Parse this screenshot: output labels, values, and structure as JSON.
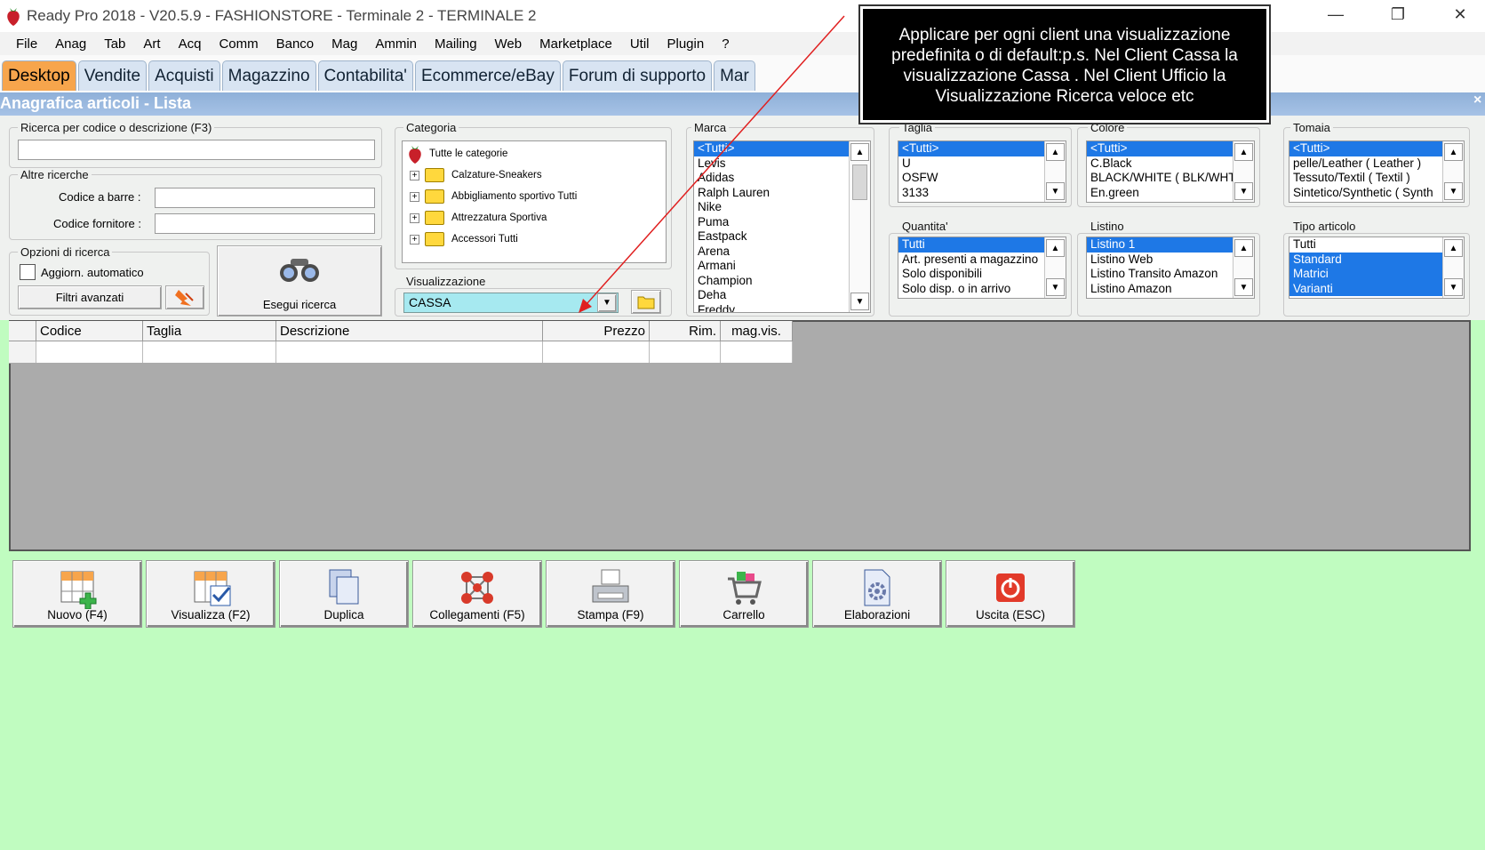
{
  "window": {
    "title": "Ready Pro 2018 - V20.5.9 - FASHIONSTORE - Terminale 2 - TERMINALE 2",
    "minimize": "—",
    "restore": "❐",
    "close": "✕"
  },
  "menu": [
    "File",
    "Anag",
    "Tab",
    "Art",
    "Acq",
    "Comm",
    "Banco",
    "Mag",
    "Ammin",
    "Mailing",
    "Web",
    "Marketplace",
    "Util",
    "Plugin",
    "?"
  ],
  "tabs": [
    "Desktop",
    "Vendite",
    "Acquisti",
    "Magazzino",
    "Contabilita'",
    "Ecommerce/eBay",
    "Forum di supporto",
    "Mar"
  ],
  "panel": {
    "title": "Anagrafica articoli  - Lista",
    "close": "×"
  },
  "search": {
    "label": "Ricerca per codice o descrizione (F3)",
    "value": ""
  },
  "other": {
    "label": "Altre ricerche",
    "barcode_label": "Codice a barre :",
    "supplier_label": "Codice fornitore :"
  },
  "options": {
    "label": "Opzioni di ricerca",
    "auto_update": "Aggiorn. automatico",
    "advanced": "Filtri avanzati",
    "run": "Esegui ricerca"
  },
  "categoria": {
    "label": "Categoria",
    "root": "Tutte le categorie",
    "items": [
      "Calzature-Sneakers",
      "Abbigliamento sportivo Tutti",
      "Attrezzatura Sportiva",
      "Accessori Tutti"
    ]
  },
  "visualizzazione": {
    "label": "Visualizzazione",
    "value": "CASSA"
  },
  "marca": {
    "label": "Marca",
    "items": [
      "<Tutti>",
      "Levis",
      "Adidas",
      "Ralph Lauren",
      "Nike",
      "Puma",
      "Eastpack",
      "Arena",
      "Armani",
      "Champion",
      "Deha",
      "Freddy"
    ]
  },
  "taglia": {
    "label": "Taglia",
    "items": [
      "<Tutti>",
      "U",
      "OSFW",
      "3133"
    ]
  },
  "colore": {
    "label": "Colore",
    "items": [
      "<Tutti>",
      "C.Black",
      "BLACK/WHITE ( BLK/WHT",
      "En.green"
    ]
  },
  "tomaia": {
    "label": "Tomaia",
    "items": [
      "<Tutti>",
      "pelle/Leather ( Leather )",
      "Tessuto/Textil ( Textil )",
      "Sintetico/Synthetic ( Synth"
    ]
  },
  "quantita": {
    "label": "Quantita'",
    "items": [
      "Tutti",
      "Art. presenti a magazzino",
      "Solo disponibili",
      "Solo disp. o in arrivo"
    ]
  },
  "listino": {
    "label": "Listino",
    "items": [
      "Listino 1",
      "Listino Web",
      "Listino Transito Amazon",
      "Listino Amazon"
    ]
  },
  "tipo": {
    "label": "Tipo articolo",
    "items": [
      "Tutti",
      "Standard",
      "Matrici",
      "Varianti"
    ]
  },
  "grid": {
    "columns": [
      "Codice",
      "Taglia",
      "Descrizione",
      "Prezzo",
      "Rim.",
      "mag.vis."
    ]
  },
  "actions": [
    "Nuovo (F4)",
    "Visualizza (F2)",
    "Duplica",
    "Collegamenti (F5)",
    "Stampa (F9)",
    "Carrello",
    "Elaborazioni",
    "Uscita (ESC)"
  ],
  "callout": {
    "text": "Applicare per ogni client una visualizzazione predefinita o di default:p.s. Nel Client Cassa la visualizzazione Cassa . Nel Client Ufficio la Visualizzazione  Ricerca veloce etc"
  },
  "colors": {
    "accent_tab": "#f7a54c",
    "selection": "#1e78e6",
    "background": "#c0fcc0",
    "callout": "#000000"
  }
}
